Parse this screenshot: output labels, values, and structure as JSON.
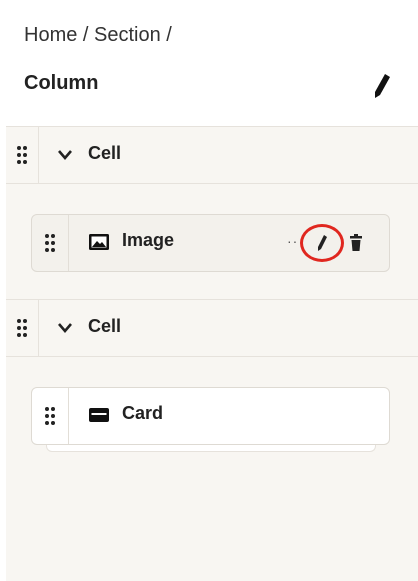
{
  "breadcrumb": "Home / Section /",
  "title": "Column",
  "cells": [
    {
      "label": "Cell",
      "items": [
        {
          "label": "Image",
          "icon": "image-icon",
          "more": "··"
        }
      ]
    },
    {
      "label": "Cell",
      "items": [
        {
          "label": "Card",
          "icon": "card-icon"
        }
      ]
    }
  ],
  "colors": {
    "highlight": "#e0271f",
    "panel_bg": "#f8f6f2",
    "item_bg": "#f3f1ec"
  }
}
